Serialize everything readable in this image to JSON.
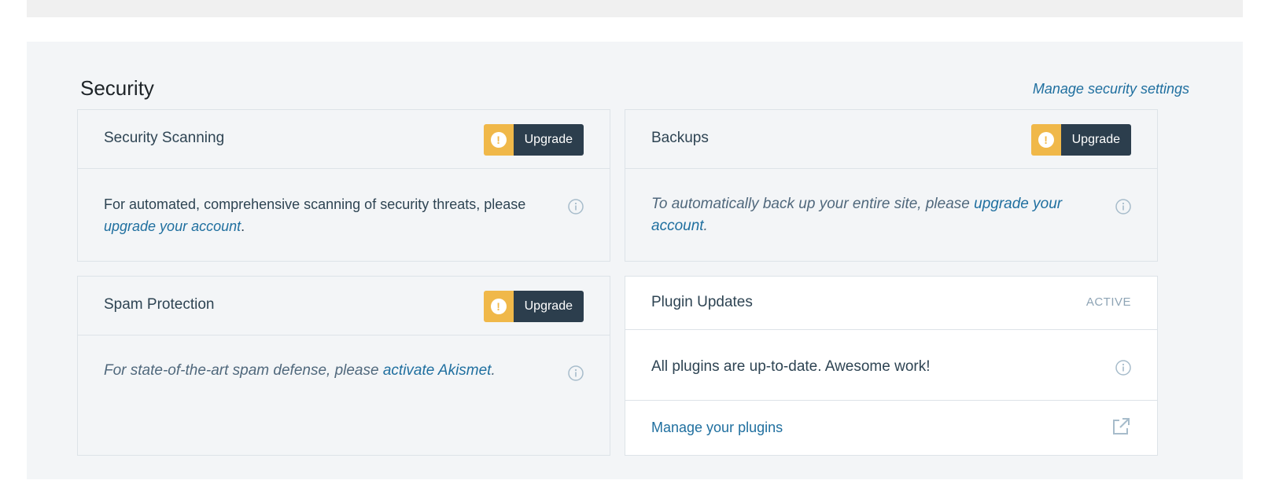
{
  "section": {
    "title": "Security",
    "manage_link": "Manage security settings"
  },
  "cards": {
    "security_scanning": {
      "title": "Security Scanning",
      "upgrade_label": "Upgrade",
      "text_before": "For automated, comprehensive scanning of security threats, please ",
      "link": "upgrade your account",
      "text_after": "."
    },
    "backups": {
      "title": "Backups",
      "upgrade_label": "Upgrade",
      "text_before": "To automatically back up your entire site, please ",
      "link": "upgrade your account",
      "text_after": "."
    },
    "spam_protection": {
      "title": "Spam Protection",
      "upgrade_label": "Upgrade",
      "text_before": "For state-of-the-art spam defense, please ",
      "link": "activate Akismet",
      "text_after": "."
    },
    "plugin_updates": {
      "title": "Plugin Updates",
      "status": "ACTIVE",
      "text": "All plugins are up-to-date. Awesome work!",
      "footer_link": "Manage your plugins"
    }
  },
  "warning_glyph": "!",
  "colors": {
    "accent_link": "#1f6f9f",
    "upgrade_dark": "#2c3e4d",
    "warning": "#f0b849",
    "panel_bg": "#f3f5f7",
    "status_muted": "#8ea4b5"
  },
  "icons": [
    "alert-icon",
    "info-icon",
    "external-link-icon"
  ]
}
